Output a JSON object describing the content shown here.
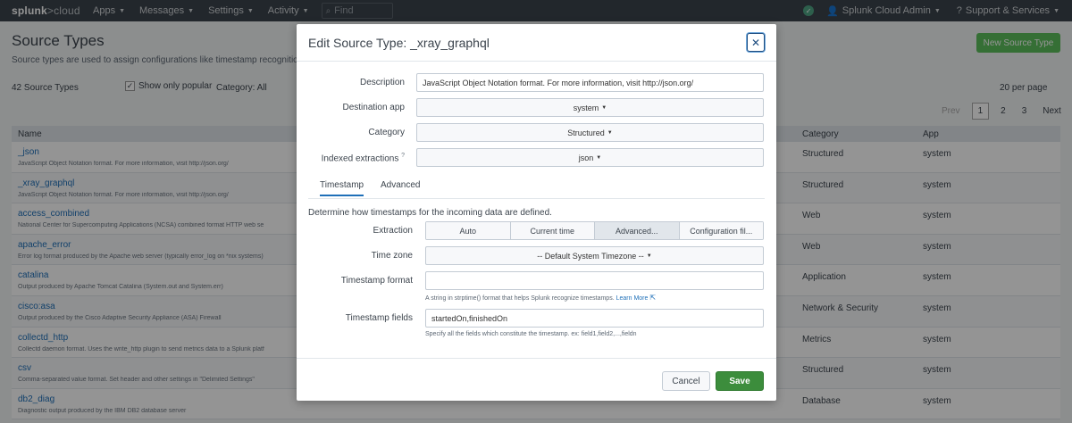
{
  "nav": {
    "logo_main": "splunk",
    "logo_suffix": ">cloud",
    "menu": [
      {
        "label": "Apps"
      },
      {
        "label": "Messages"
      },
      {
        "label": "Settings"
      },
      {
        "label": "Activity"
      }
    ],
    "search_placeholder": "Find",
    "user": "Splunk Cloud Admin",
    "support": "Support & Services"
  },
  "page": {
    "title": "Source Types",
    "subtitle": "Source types are used to assign configurations like timestamp recognition, ev",
    "new_button": "New Source Type",
    "count": "42 Source Types",
    "show_popular": "Show only popular",
    "category_filter": "Category: All",
    "per_page": "20 per page",
    "pager": {
      "prev": "Prev",
      "pages": [
        "1",
        "2",
        "3"
      ],
      "next": "Next"
    },
    "columns": {
      "name": "Name",
      "category": "Category",
      "app": "App"
    },
    "rows": [
      {
        "name": "_json",
        "desc": "JavaScript Object Notation format. For more information, visit http://json.org/",
        "category": "Structured",
        "app": "system"
      },
      {
        "name": "_xray_graphql",
        "desc": "JavaScript Object Notation format. For more information, visit http://json.org/",
        "category": "Structured",
        "app": "system"
      },
      {
        "name": "access_combined",
        "desc": "National Center for Supercomputing Applications (NCSA) combined format HTTP web se",
        "category": "Web",
        "app": "system"
      },
      {
        "name": "apache_error",
        "desc": "Error log format produced by the Apache web server (typically error_log on *nix systems)",
        "category": "Web",
        "app": "system"
      },
      {
        "name": "catalina",
        "desc": "Output produced by Apache Tomcat Catalina (System.out and System.err)",
        "category": "Application",
        "app": "system"
      },
      {
        "name": "cisco:asa",
        "desc": "Output produced by the Cisco Adaptive Security Appliance (ASA) Firewall",
        "category": "Network & Security",
        "app": "system"
      },
      {
        "name": "collectd_http",
        "desc": "Collectd daemon format. Uses the write_http plugin to send metrics data to a Splunk platf",
        "category": "Metrics",
        "app": "system"
      },
      {
        "name": "csv",
        "desc": "Comma-separated value format. Set header and other settings in \"Delimited Settings\"",
        "category": "Structured",
        "app": "system"
      },
      {
        "name": "db2_diag",
        "desc": "Diagnostic output produced by the IBM DB2 database server",
        "category": "Database",
        "app": "system"
      }
    ]
  },
  "modal": {
    "title": "Edit Source Type: _xray_graphql",
    "fields": {
      "description_label": "Description",
      "description_value": "JavaScript Object Notation format. For more information, visit http://json.org/",
      "destination_label": "Destination app",
      "destination_value": "system",
      "category_label": "Category",
      "category_value": "Structured",
      "indexed_label": "Indexed extractions",
      "indexed_help": "?",
      "indexed_value": "json"
    },
    "tabs": [
      {
        "label": "Timestamp"
      },
      {
        "label": "Advanced"
      }
    ],
    "intro": "Determine how timestamps for the incoming data are defined.",
    "extraction": {
      "label": "Extraction",
      "options": [
        "Auto",
        "Current time",
        "Advanced...",
        "Configuration fil..."
      ],
      "selected": "Advanced..."
    },
    "timezone": {
      "label": "Time zone",
      "value": "-- Default System Timezone --"
    },
    "timestamp_format": {
      "label": "Timestamp format",
      "value": "",
      "help": "A string in strptime() format that helps Splunk recognize timestamps.",
      "learn_more": "Learn More"
    },
    "timestamp_fields": {
      "label": "Timestamp fields",
      "value": "startedOn,finishedOn",
      "help": "Specify all the fields which constitute the timestamp. ex: field1,field2,...,fieldn"
    },
    "cancel": "Cancel",
    "save": "Save"
  }
}
